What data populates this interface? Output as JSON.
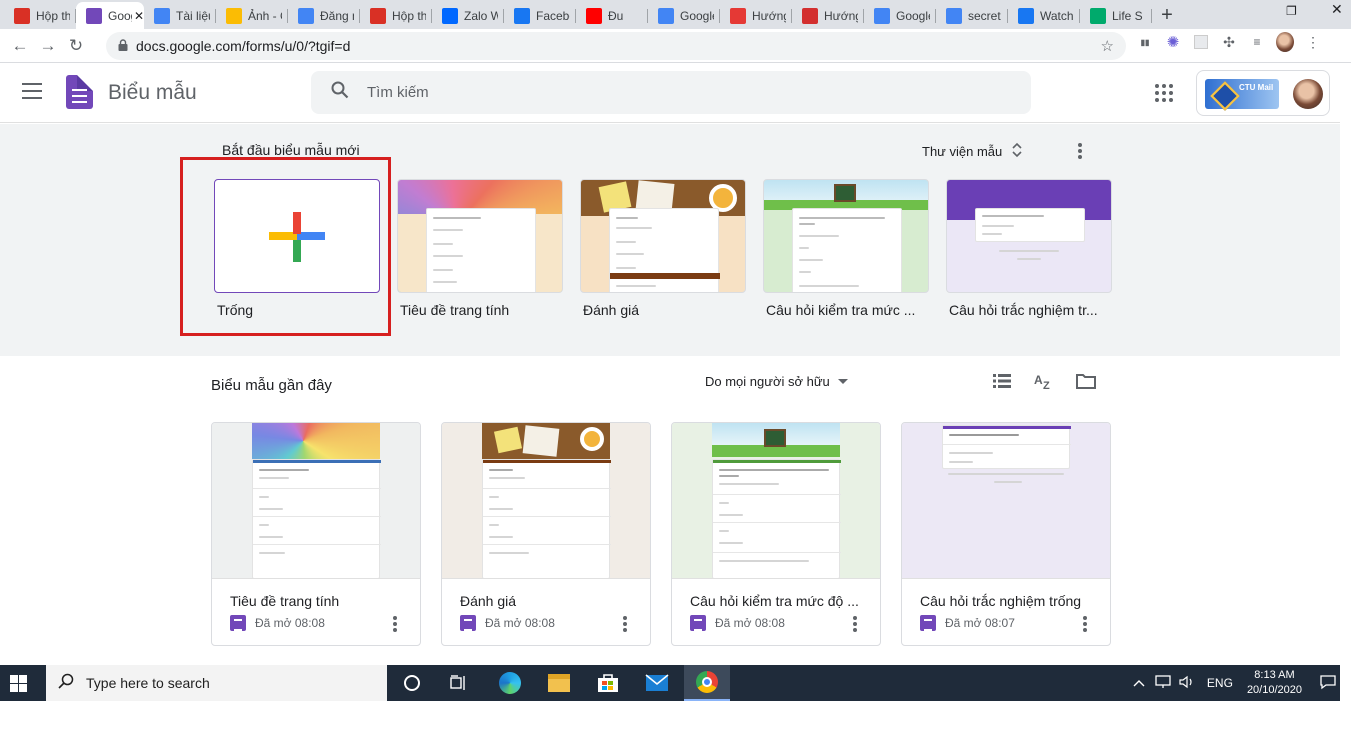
{
  "browser": {
    "tabs": [
      {
        "label": "Hộp thư",
        "icon": "gmail-icon",
        "color": "#d93025"
      },
      {
        "label": "Google Biểu mẫu",
        "icon": "forms-icon",
        "color": "#7248b9",
        "active": true
      },
      {
        "label": "Tài liệu",
        "icon": "docs-icon",
        "color": "#4285f4"
      },
      {
        "label": "Ảnh - Google",
        "icon": "photos-icon",
        "color": "#fbbc04"
      },
      {
        "label": "Đăng nhập",
        "icon": "google-icon",
        "color": "#4285f4"
      },
      {
        "label": "Hộp thư",
        "icon": "gmail-icon",
        "color": "#d93025"
      },
      {
        "label": "Zalo Web",
        "icon": "zalo-icon",
        "color": "#0068ff"
      },
      {
        "label": "Facebook",
        "icon": "facebook-icon",
        "color": "#1877f2"
      },
      {
        "label": "Đu",
        "icon": "youtube-icon",
        "color": "#ff0000"
      },
      {
        "label": "Google Dịch",
        "icon": "translate-icon",
        "color": "#4285f4"
      },
      {
        "label": "Hướng dẫn",
        "icon": "red-circle-icon",
        "color": "#e53935"
      },
      {
        "label": "Hướng dẫn",
        "icon": "n-icon",
        "color": "#d32f2f"
      },
      {
        "label": "Google Dịch",
        "icon": "translate-icon",
        "color": "#4285f4"
      },
      {
        "label": "secret",
        "icon": "google-icon",
        "color": "#4285f4"
      },
      {
        "label": "Watch",
        "icon": "facebook-icon",
        "color": "#1877f2"
      },
      {
        "label": "Life S",
        "icon": "tripadvisor-icon",
        "color": "#00aa6c"
      }
    ],
    "url": "docs.google.com/forms/u/0/?tgif=d"
  },
  "app": {
    "title": "Biểu mẫu",
    "search_placeholder": "Tìm kiếm",
    "account_logo_text": "CTU Mail"
  },
  "gallery": {
    "title": "Bắt đầu biểu mẫu mới",
    "library_label": "Thư viện mẫu",
    "templates": [
      {
        "name": "Trống"
      },
      {
        "name": "Tiêu đề trang tính"
      },
      {
        "name": "Đánh giá"
      },
      {
        "name": "Câu hỏi kiểm tra mức ..."
      },
      {
        "name": "Câu hỏi trắc nghiệm tr..."
      }
    ]
  },
  "recent": {
    "title": "Biểu mẫu gần đây",
    "owner_filter": "Do mọi người sở hữu",
    "forms": [
      {
        "name": "Tiêu đề trang tính",
        "opened": "Đã mở 08:08"
      },
      {
        "name": "Đánh giá",
        "opened": "Đã mở 08:08"
      },
      {
        "name": "Câu hỏi kiểm tra mức độ ...",
        "opened": "Đã mở 08:08"
      },
      {
        "name": "Câu hỏi trắc nghiệm trống",
        "opened": "Đã mở 08:07"
      }
    ]
  },
  "taskbar": {
    "search_placeholder": "Type here to search",
    "lang": "ENG",
    "time": "8:13 AM",
    "date": "20/10/2020"
  },
  "colors": {
    "forms_purple": "#7248b9",
    "highlight_red": "#d61f1f",
    "gallery_bg": "#f1f3f4"
  }
}
